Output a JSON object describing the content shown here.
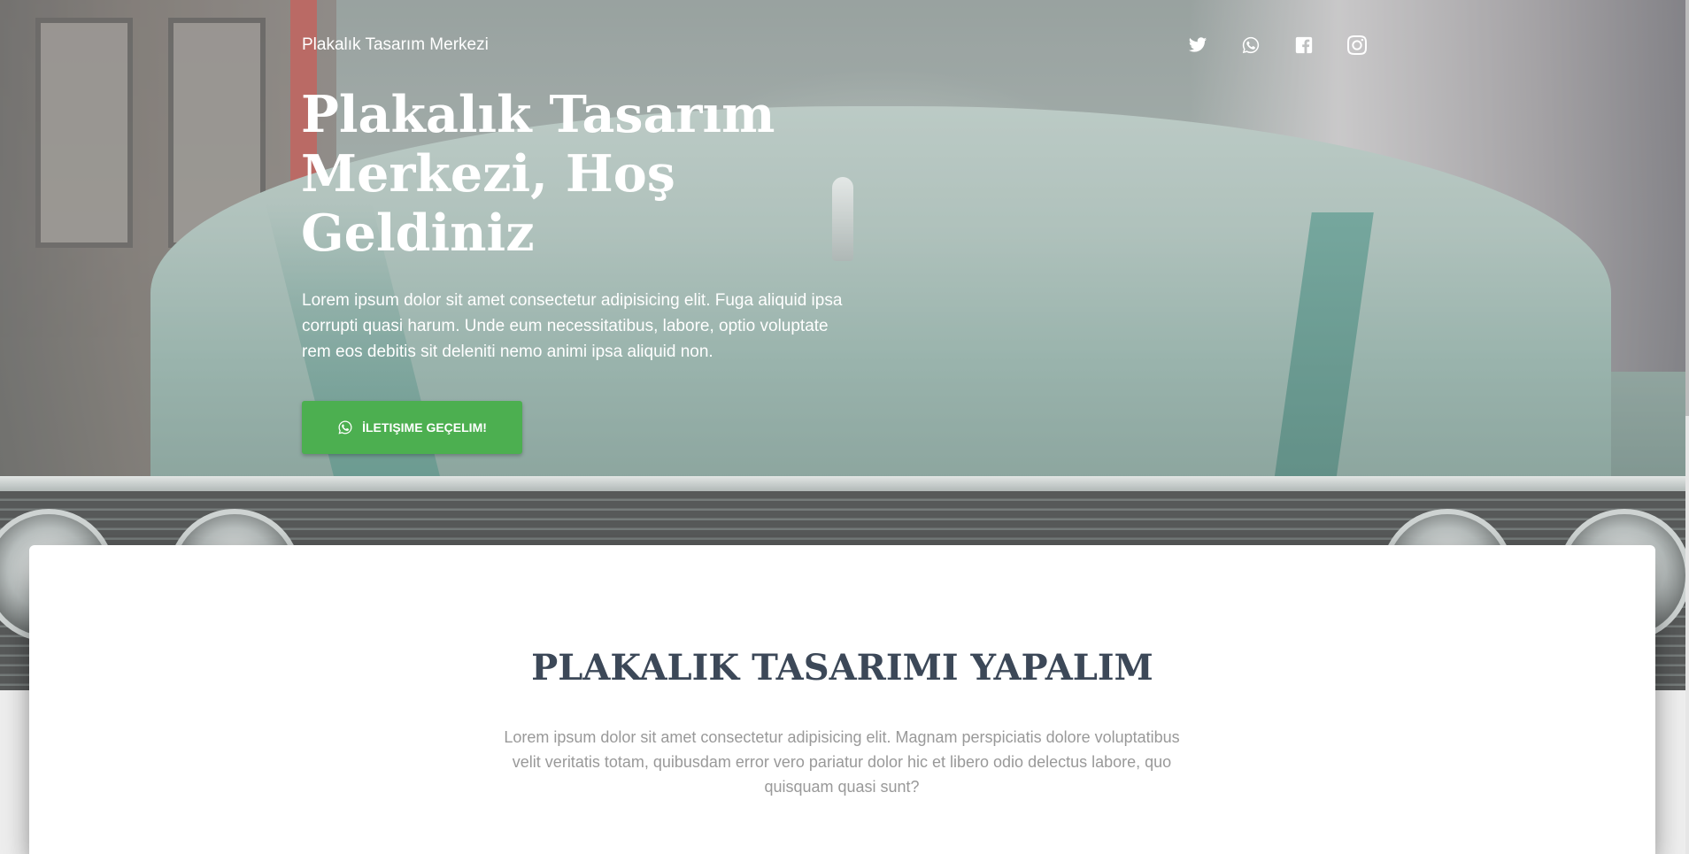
{
  "header": {
    "brand": "Plakalık Tasarım Merkezi",
    "socials": [
      {
        "name": "twitter-icon"
      },
      {
        "name": "whatsapp-icon"
      },
      {
        "name": "facebook-icon"
      },
      {
        "name": "instagram-icon"
      }
    ]
  },
  "hero": {
    "title": "Plakalık Tasarım Merkezi, Hoş Geldiniz",
    "description": "Lorem ipsum dolor sit amet consectetur adipisicing elit. Fuga aliquid ipsa corrupti quasi harum. Unde eum necessitatibus, labore, optio voluptate rem eos debitis sit deleniti nemo animi ipsa aliquid non.",
    "cta_label": "İletişime Geçelim!",
    "cta_icon": "whatsapp-icon",
    "cta_color": "#4caf50"
  },
  "section": {
    "title": "PLAKALIK TASARIMI YAPALIM",
    "description": "Lorem ipsum dolor sit amet consectetur adipisicing elit. Magnam perspiciatis dolore voluptatibus velit veritatis totam, quibusdam error vero pariatur dolor hic et libero odio delectus labore, quo quisquam quasi sunt?"
  },
  "colors": {
    "heading": "#3c4858",
    "muted_text": "#999999",
    "card_bg": "#ffffff"
  }
}
